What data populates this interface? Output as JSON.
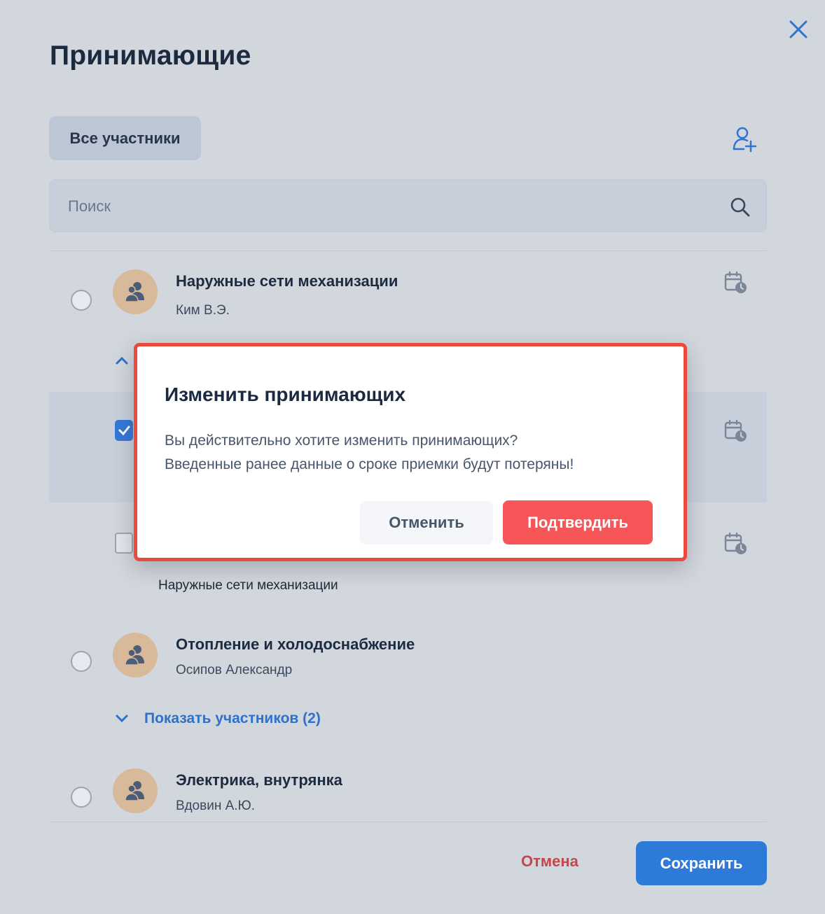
{
  "page": {
    "title": "Принимающие"
  },
  "toolbar": {
    "filter_label": "Все участники"
  },
  "search": {
    "placeholder": "Поиск"
  },
  "groups": [
    {
      "title": "Наружные сети механизации",
      "person": "Ким В.Э."
    },
    {
      "title": "Отопление и холодоснабжение",
      "person": "Осипов Александр"
    },
    {
      "title": "Электрика, внутрянка",
      "person": "Вдовин А.Ю."
    }
  ],
  "member_caption": "Наружные сети механизации",
  "show_members_label": "Показать участников (2)",
  "footer": {
    "cancel_label": "Отмена",
    "save_label": "Сохранить"
  },
  "dialog": {
    "title": "Изменить принимающих",
    "lines": [
      "Вы действительно хотите изменить принимающих?",
      "Введенные ранее данные о сроке приемки будут потеряны!"
    ],
    "cancel_label": "Отменить",
    "confirm_label": "Подтвердить"
  },
  "colors": {
    "accent": "#2e7ad8",
    "danger": "#f65658",
    "highlight_border": "#ea4a3b"
  },
  "icons": [
    "close-icon",
    "add-user-icon",
    "search-icon",
    "group-icon",
    "calendar-clock-icon",
    "chevron-up-icon",
    "chevron-down-icon",
    "check-icon"
  ]
}
